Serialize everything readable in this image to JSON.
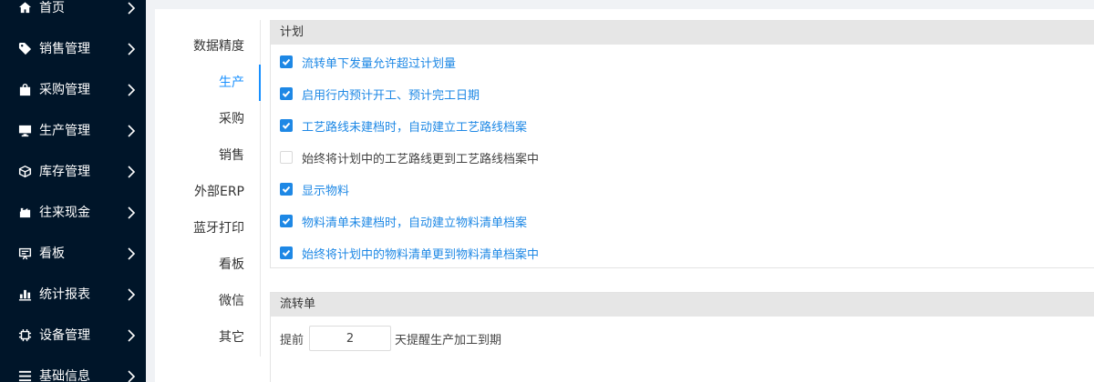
{
  "sidebar": {
    "items": [
      {
        "label": "首页",
        "icon": "home-icon"
      },
      {
        "label": "销售管理",
        "icon": "tag-icon"
      },
      {
        "label": "采购管理",
        "icon": "shopping-bag-icon"
      },
      {
        "label": "生产管理",
        "icon": "monitor-icon"
      },
      {
        "label": "库存管理",
        "icon": "cube-icon"
      },
      {
        "label": "往来现金",
        "icon": "money-icon"
      },
      {
        "label": "看板",
        "icon": "board-icon"
      },
      {
        "label": "统计报表",
        "icon": "bar-chart-icon"
      },
      {
        "label": "设备管理",
        "icon": "chip-icon"
      },
      {
        "label": "基础信息",
        "icon": "list-icon"
      }
    ]
  },
  "tabs": {
    "items": [
      "数据精度",
      "生产",
      "采购",
      "销售",
      "外部ERP",
      "蓝牙打印",
      "看板",
      "微信",
      "其它"
    ],
    "active": "生产"
  },
  "plan": {
    "title": "计划",
    "options": [
      {
        "label": "流转单下发量允许超过计划量",
        "checked": true
      },
      {
        "label": "启用行内预计开工、预计完工日期",
        "checked": true
      },
      {
        "label": "工艺路线未建档时，自动建立工艺路线档案",
        "checked": true
      },
      {
        "label": "始终将计划中的工艺路线更到工艺路线档案中",
        "checked": false
      },
      {
        "label": "显示物料",
        "checked": true
      },
      {
        "label": "物料清单未建档时，自动建立物料清单档案",
        "checked": true
      },
      {
        "label": "始终将计划中的物料清单更到物料清单档案中",
        "checked": true
      }
    ]
  },
  "flow": {
    "title": "流转单",
    "prefix": "提前",
    "days_value": "2",
    "suffix": "天提醒生产加工到期"
  },
  "colors": {
    "sidebar_bg": "#001529",
    "accent": "#1e88e5",
    "active_tab": "#1890ff"
  }
}
